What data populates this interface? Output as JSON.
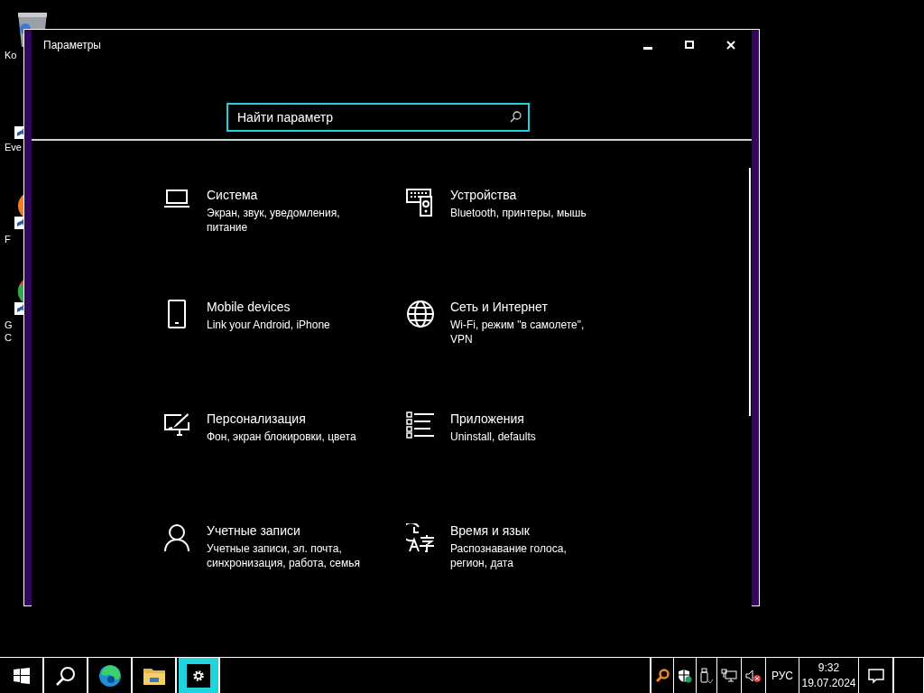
{
  "desktop_icons": [
    {
      "label_lines": [
        "Ko"
      ]
    },
    {
      "label_lines": [
        "Eve"
      ]
    },
    {
      "label_lines": [
        "F"
      ]
    },
    {
      "label_lines": [
        "G",
        "C"
      ]
    }
  ],
  "window": {
    "title": "Параметры",
    "search": {
      "placeholder": "Найти параметр"
    },
    "categories": [
      {
        "title": "Система",
        "subtitle": "Экран, звук, уведомления, питание"
      },
      {
        "title": "Устройства",
        "subtitle": "Bluetooth, принтеры, мышь"
      },
      {
        "title": "Mobile devices",
        "subtitle": "Link your Android, iPhone"
      },
      {
        "title": "Сеть и Интернет",
        "subtitle": "Wi-Fi, режим \"в самолете\", VPN"
      },
      {
        "title": "Персонализация",
        "subtitle": "Фон, экран блокировки, цвета"
      },
      {
        "title": "Приложения",
        "subtitle": "Uninstall, defaults"
      },
      {
        "title": "Учетные записи",
        "subtitle": "Учетные записи, эл. почта, синхронизация, работа, семья"
      },
      {
        "title": "Время и язык",
        "subtitle": "Распознавание голоса, регион, дата"
      }
    ]
  },
  "taskbar": {
    "apps": [
      {
        "kind": "start",
        "selected": false
      },
      {
        "kind": "search",
        "selected": false
      },
      {
        "kind": "edge",
        "selected": false
      },
      {
        "kind": "explorer",
        "selected": false
      },
      {
        "kind": "settings",
        "selected": true
      }
    ],
    "language": "РУС",
    "time": "9:32",
    "date": "19.07.2024"
  }
}
